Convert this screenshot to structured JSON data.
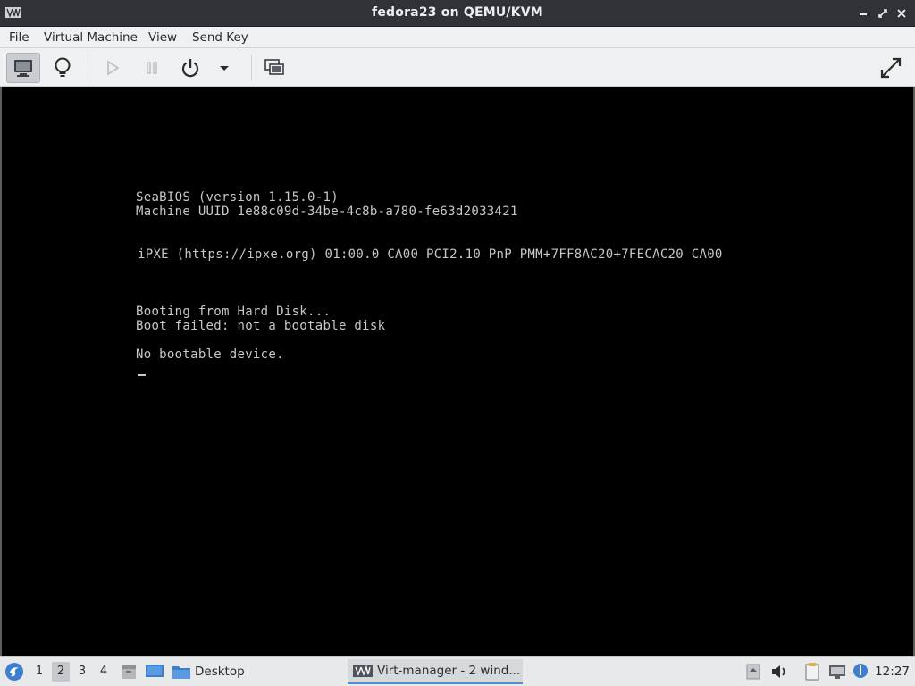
{
  "window": {
    "title": "fedora23 on QEMU/KVM",
    "app_icon": "virt-manager-icon",
    "controls": [
      "minimize-icon",
      "restore-icon",
      "close-icon"
    ]
  },
  "menubar": {
    "items": [
      "File",
      "Virtual Machine",
      "View",
      "Send Key"
    ]
  },
  "toolbar": {
    "buttons": [
      {
        "name": "console-icon",
        "active": true
      },
      {
        "name": "details-icon",
        "active": false
      },
      {
        "name": "run-icon",
        "active": false,
        "disabled": true
      },
      {
        "name": "pause-icon",
        "active": false,
        "disabled": true
      },
      {
        "name": "power-icon",
        "active": false
      },
      {
        "name": "power-menu-dropdown-icon",
        "active": false
      },
      {
        "name": "snapshots-icon",
        "active": false
      },
      {
        "name": "fullscreen-icon",
        "active": false
      }
    ]
  },
  "console": {
    "lines": [
      "SeaBIOS (version 1.15.0-1)",
      "Machine UUID 1e88c09d-34be-4c8b-a780-fe63d2033421",
      "iPXE (https://ipxe.org) 01:00.0 CA00 PCI2.10 PnP PMM+7FF8AC20+7FECAC20 CA00",
      "Booting from Hard Disk...",
      "Boot failed: not a bootable disk",
      "No bootable device."
    ],
    "text_color": "#c8c8c8",
    "background": "#000000"
  },
  "taskbar": {
    "workspaces": [
      "1",
      "2",
      "3",
      "4"
    ],
    "active_workspace": "2",
    "desktop_label": "Desktop",
    "window_task_label": "Virt-manager - 2 wind...",
    "clock": "12:27",
    "tray_icons": [
      "tray-scroll-icon",
      "volume-icon",
      "clipboard-icon",
      "network-icon",
      "updates-icon"
    ],
    "accent": "#4a8fd6"
  }
}
